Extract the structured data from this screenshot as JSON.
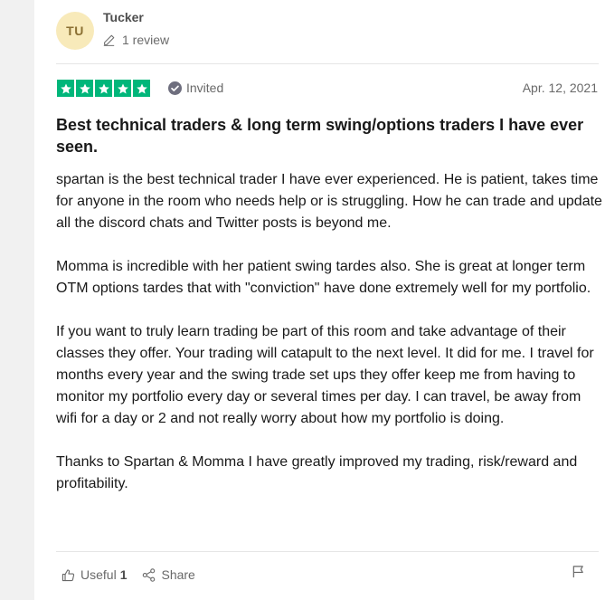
{
  "reviewer": {
    "initials": "TU",
    "name": "Tucker",
    "review_count": "1 review"
  },
  "review": {
    "rating": 5,
    "rating_max": 5,
    "status": "Invited",
    "date": "Apr. 12, 2021",
    "title": "Best technical traders & long term swing/options traders I have ever seen.",
    "paragraphs": [
      "spartan is the best technical trader I have ever experienced. He is patient, takes time for anyone in the room who needs help or is struggling. How he can trade and update all the discord chats and Twitter posts is beyond me.",
      "Momma is incredible with her patient swing tardes also. She is great at longer term OTM options tardes that with \"conviction\" have done extremely well for my portfolio.",
      "If you want to truly learn trading be part of this room and take advantage of their classes they offer. Your trading will catapult to the next level. It did for me. I travel for months every year and the swing trade set ups they offer keep me from having to monitor my portfolio every day or several times per day. I can travel, be away from wifi for a day or 2 and not really worry about how my portfolio is doing.",
      "Thanks to Spartan & Momma I have greatly improved my trading, risk/reward and profitability."
    ]
  },
  "actions": {
    "useful_label": "Useful",
    "useful_count": "1",
    "share_label": "Share"
  },
  "icons": {
    "edit": "pencil-icon",
    "invited": "check-circle-icon",
    "star": "star-icon",
    "useful": "thumbs-up-icon",
    "share": "share-icon",
    "report": "flag-icon"
  },
  "colors": {
    "star_green": "#00b67a",
    "avatar_bg": "#f8eaba",
    "avatar_text": "#8b7033",
    "muted_text": "#696969"
  }
}
